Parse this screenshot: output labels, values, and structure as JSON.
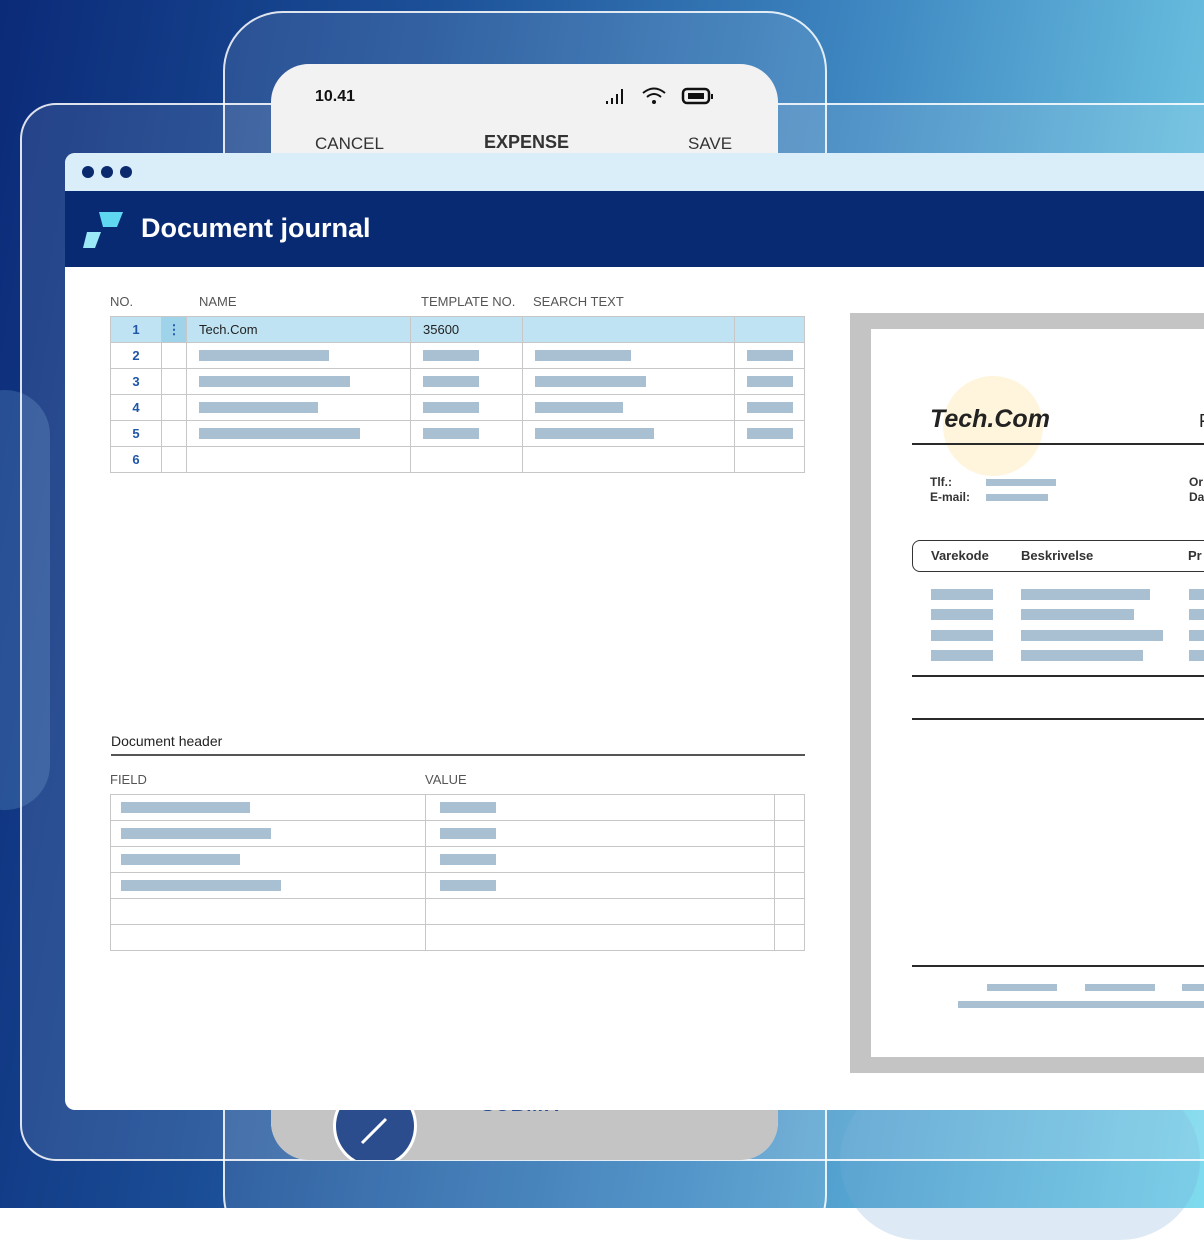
{
  "phone": {
    "time": "10.41",
    "cancel_label": "CANCEL",
    "title": "EXPENSE",
    "save_label": "SAVE",
    "submit_label": "SUBMIT"
  },
  "app": {
    "title": "Document journal"
  },
  "journal": {
    "columns": {
      "no": "NO.",
      "name": "NAME",
      "template": "TEMPLATE NO.",
      "search": "SEARCH TEXT"
    },
    "rows": [
      {
        "no": "1",
        "name": "Tech.Com",
        "template": "35600",
        "search": ""
      },
      {
        "no": "2"
      },
      {
        "no": "3"
      },
      {
        "no": "4"
      },
      {
        "no": "5"
      },
      {
        "no": "6"
      }
    ],
    "kebab": "⋮"
  },
  "doc_header": {
    "title": "Document header",
    "field_label": "FIELD",
    "value_label": "VALUE"
  },
  "preview": {
    "company": "Tech.Com",
    "right_header_letter": "F",
    "tlf_label": "Tlf.:",
    "email_label": "E-mail:",
    "right_label_1": "Or",
    "right_label_2": "Da",
    "col_varekode": "Varekode",
    "col_beskrivelse": "Beskrivelse",
    "col_pr": "Pr"
  },
  "colors": {
    "header_bg": "#082a73",
    "accent": "#1f56a7",
    "selected_row": "#bfe3f2",
    "placeholder_bar": "#a9bfd2"
  }
}
